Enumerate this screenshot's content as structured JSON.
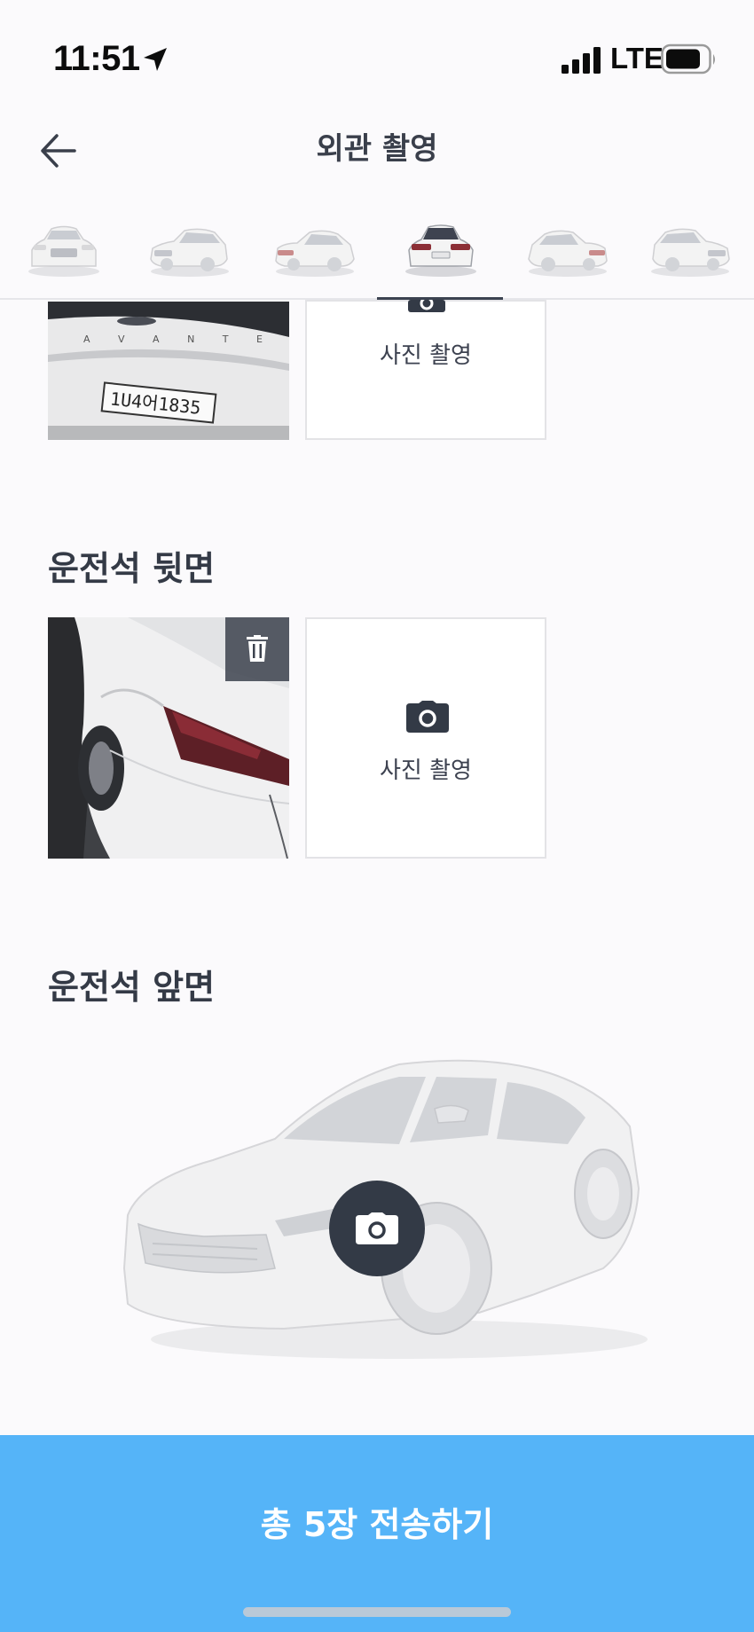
{
  "status_bar": {
    "time": "11:51",
    "network": "LTE"
  },
  "nav": {
    "title": "외관 촬영"
  },
  "thumbnails": [
    {
      "view": "front"
    },
    {
      "view": "front-left"
    },
    {
      "view": "rear-left"
    },
    {
      "view": "rear",
      "selected": true
    },
    {
      "view": "rear-right"
    },
    {
      "view": "front-right"
    }
  ],
  "rear_section": {
    "capture_label": "사진 촬영"
  },
  "driver_rear_section": {
    "heading": "운전석 뒷면",
    "capture_label": "사진 촬영"
  },
  "driver_front_section": {
    "heading": "운전석 앞면"
  },
  "submit": {
    "label": "총 5장 전송하기"
  },
  "colors": {
    "accent": "#55b4f8",
    "dark": "#333a46",
    "background": "#fbfafc"
  },
  "icons": [
    "location-arrow-icon",
    "signal-icon",
    "battery-icon",
    "back-arrow-icon",
    "camera-icon",
    "trash-icon"
  ]
}
